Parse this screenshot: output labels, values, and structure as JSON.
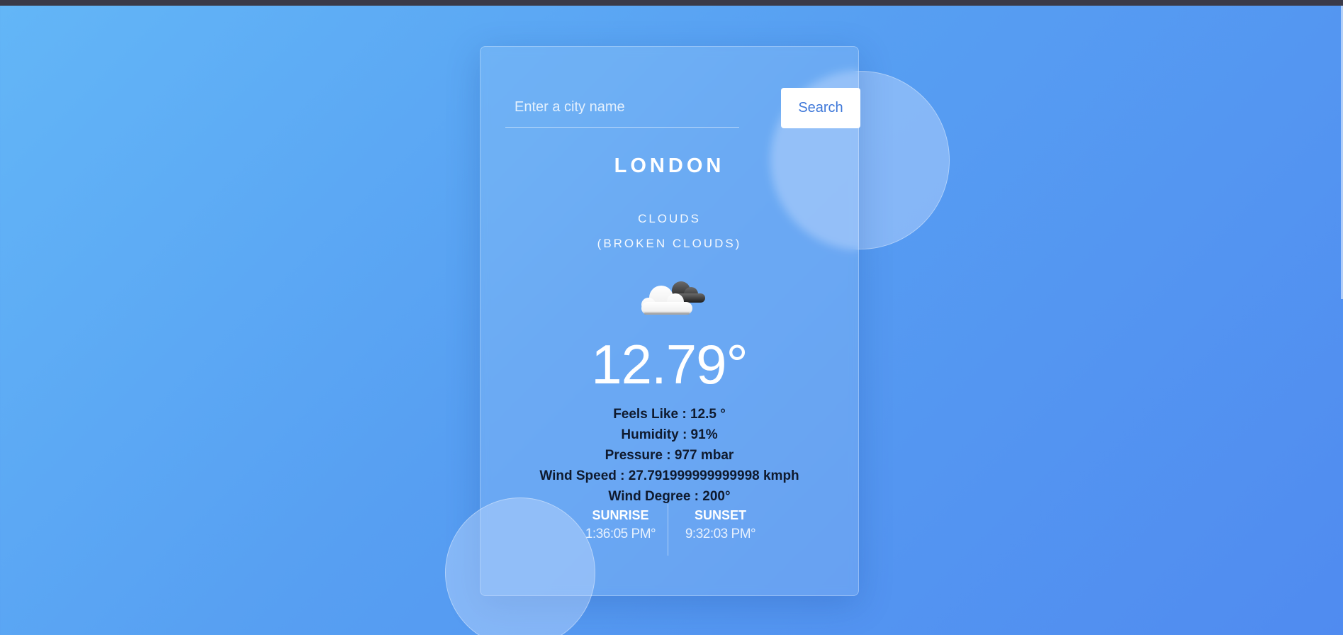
{
  "search": {
    "placeholder": "Enter a city name",
    "value": "",
    "button_label": "Search"
  },
  "weather": {
    "city": "LONDON",
    "condition_main": "CLOUDS",
    "condition_detail": "(BROKEN CLOUDS)",
    "icon": "broken-clouds-icon",
    "temperature": "12.79°",
    "feels_like": "Feels Like : 12.5 °",
    "humidity": "Humidity : 91%",
    "pressure": "Pressure : 977 mbar",
    "wind_speed": "Wind Speed : 27.791999999999998 kmph",
    "wind_degree": "Wind Degree : 200°"
  },
  "sun": {
    "sunrise_label": "SUNRISE",
    "sunrise_time": "1:36:05 PM°",
    "sunset_label": "SUNSET",
    "sunset_time": "9:32:03 PM°"
  },
  "colors": {
    "background_start": "#63b6f7",
    "background_end": "#508bf0",
    "button_text": "#3f78d9",
    "stats_text": "#0f1a2e"
  }
}
